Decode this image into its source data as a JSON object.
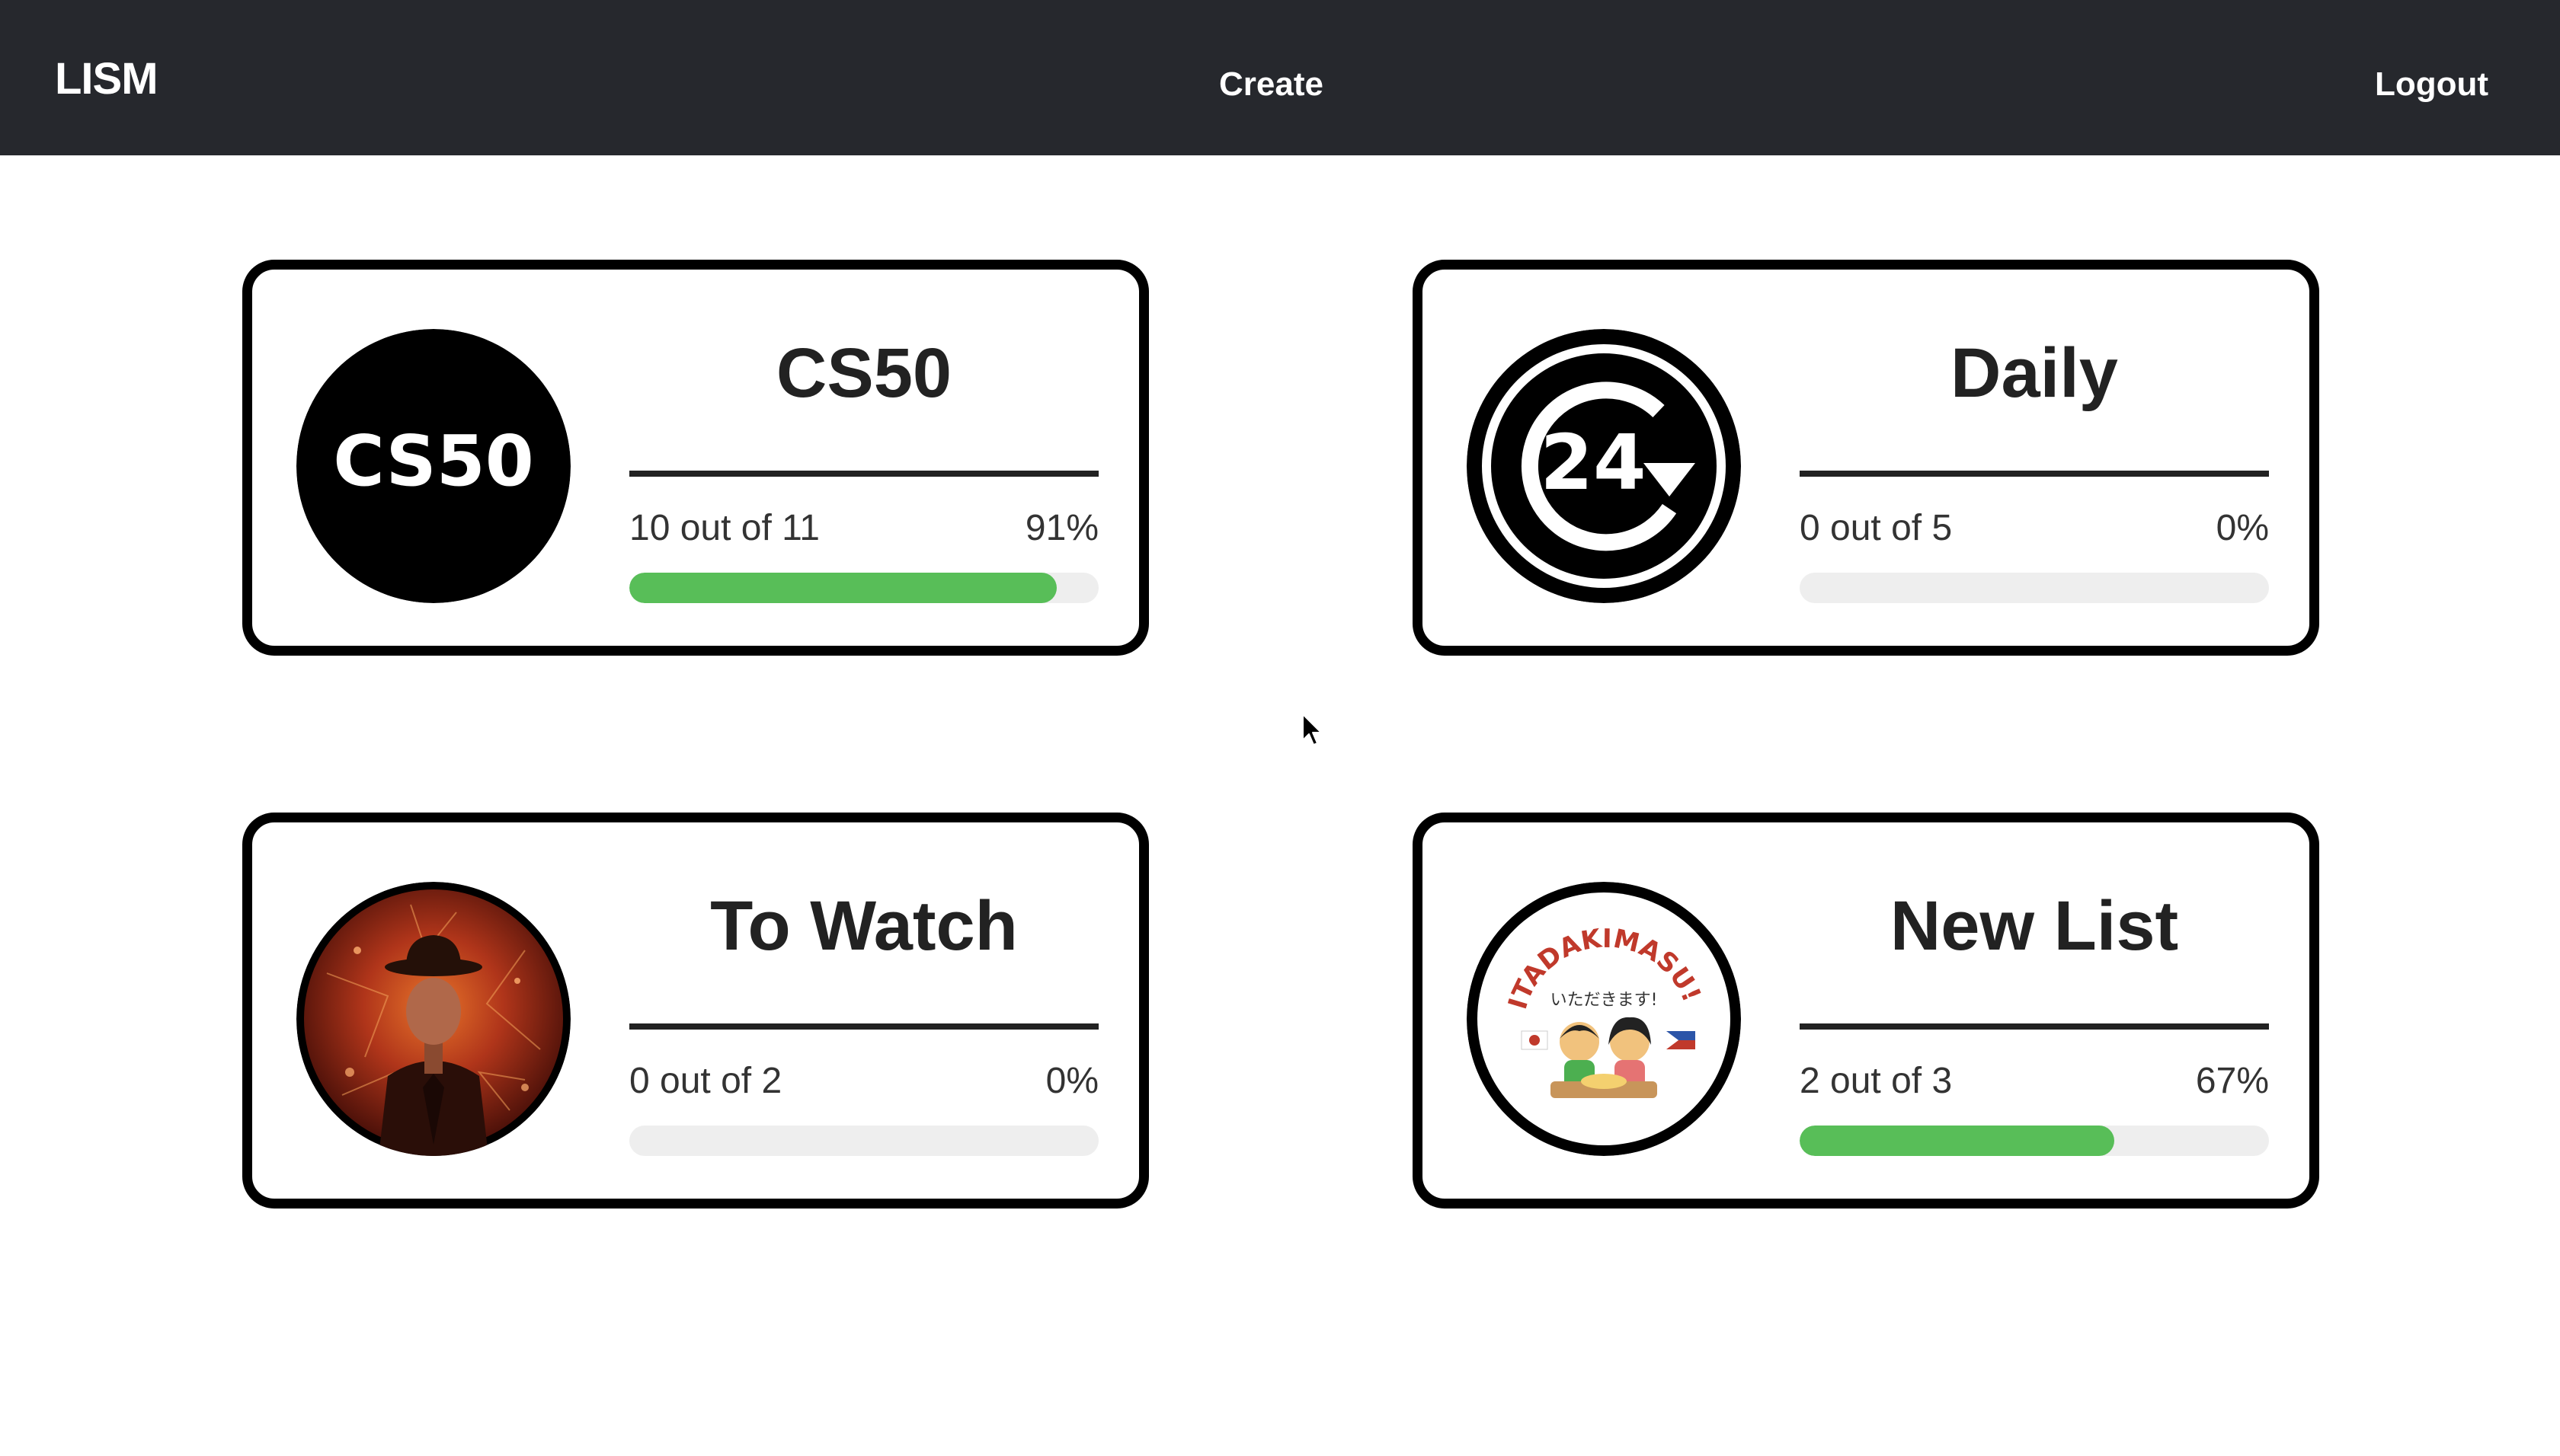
{
  "navbar": {
    "brand": "LISM",
    "create_label": "Create",
    "logout_label": "Logout",
    "background": "#26282d"
  },
  "cards": [
    {
      "title": "CS50",
      "count_text": "10 out of 11",
      "percent_text": "91%",
      "progress": 0.91,
      "logo_text": "CS50",
      "icon": "cs50-logo-icon"
    },
    {
      "title": "Daily",
      "count_text": "0 out of 5",
      "percent_text": "0%",
      "progress": 0,
      "logo_text": "24",
      "icon": "24-hour-refresh-icon"
    },
    {
      "title": "To Watch",
      "count_text": "0 out of 2",
      "percent_text": "0%",
      "progress": 0,
      "icon": "movie-poster-image"
    },
    {
      "title": "New List",
      "count_text": "2 out of 3",
      "percent_text": "67%",
      "progress": 0.67,
      "logo_text": "ITADAKIMASU!",
      "logo_subtext": "いただきます!",
      "icon": "itadakimasu-sticker-image"
    }
  ],
  "colors": {
    "progress_fill": "#58be58",
    "progress_track": "#eeeeee",
    "card_border": "#000000"
  }
}
